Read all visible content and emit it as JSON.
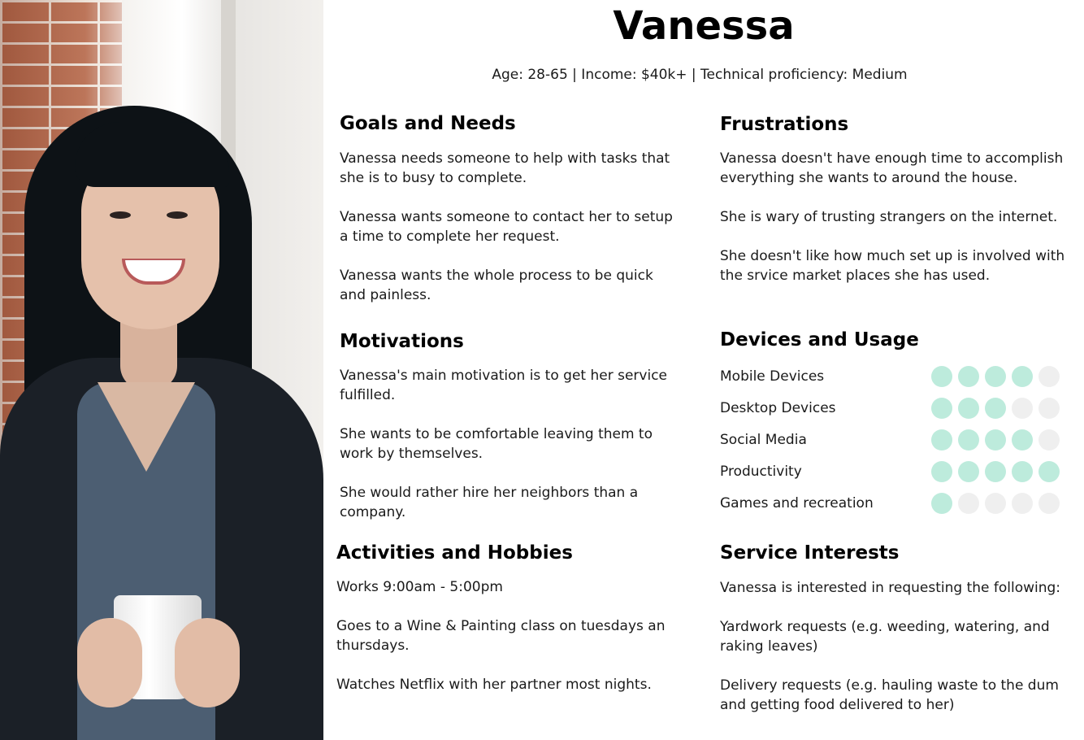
{
  "persona": {
    "name": "Vanessa",
    "summary": "Age: 28-65 | Income: $40k+ | Technical proficiency: Medium"
  },
  "goals": {
    "heading": "Goals and Needs",
    "items": [
      "Vanessa needs someone to help with tasks that she is to busy to complete.",
      "Vanessa wants someone to contact her to setup a time to complete her request.",
      "Vanessa wants the whole process to be quick and painless."
    ]
  },
  "frustrations": {
    "heading": "Frustrations",
    "items": [
      "Vanessa doesn't have enough time to accomplish everything she wants to around the house.",
      "She is wary of trusting strangers on the internet.",
      "She doesn't like how much set up is involved with the srvice market places she has used."
    ]
  },
  "motivations": {
    "heading": "Motivations",
    "items": [
      "Vanessa's main motivation is to get her service fulfilled.",
      "She wants to be comfortable leaving them to work by themselves.",
      "She would rather hire her neighbors than a company."
    ]
  },
  "devices": {
    "heading": "Devices and Usage",
    "max_rating": 5,
    "filled_color": "#bdebdc",
    "empty_color": "#efefef",
    "rows": [
      {
        "label": "Mobile Devices",
        "rating": 4
      },
      {
        "label": "Desktop Devices",
        "rating": 3
      },
      {
        "label": "Social Media",
        "rating": 4
      },
      {
        "label": "Productivity",
        "rating": 5
      },
      {
        "label": "Games and recreation",
        "rating": 1
      }
    ]
  },
  "activities": {
    "heading": "Activities and Hobbies",
    "items": [
      "Works 9:00am - 5:00pm",
      "Goes to a Wine & Painting class on tuesdays an thursdays.",
      "Watches Netflix with her partner most nights."
    ]
  },
  "service_interests": {
    "heading": "Service Interests",
    "items": [
      "Vanessa is interested in requesting the following:",
      "Yardwork requests (e.g. weeding, watering, and raking leaves)",
      "Delivery requests (e.g. hauling waste to the dum and getting food delivered to her)"
    ]
  }
}
